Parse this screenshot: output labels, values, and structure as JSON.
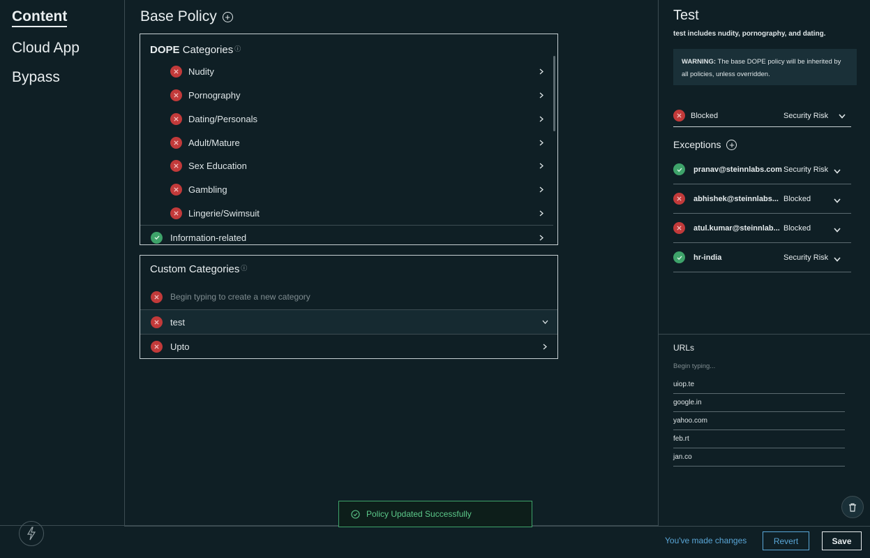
{
  "sidebar": {
    "items": [
      {
        "label": "Content"
      },
      {
        "label": "Cloud App"
      },
      {
        "label": "Bypass"
      }
    ]
  },
  "main": {
    "title": "Base Policy",
    "dope_panel": {
      "heading_bold": "DOPE",
      "heading_rest": "Categories",
      "items": [
        {
          "label": "Nudity",
          "status": "blocked"
        },
        {
          "label": "Pornography",
          "status": "blocked"
        },
        {
          "label": "Dating/Personals",
          "status": "blocked"
        },
        {
          "label": "Adult/Mature",
          "status": "blocked"
        },
        {
          "label": "Sex Education",
          "status": "blocked"
        },
        {
          "label": "Gambling",
          "status": "blocked"
        },
        {
          "label": "Lingerie/Swimsuit",
          "status": "blocked"
        }
      ],
      "next_group": {
        "label": "Information-related",
        "status": "allowed"
      }
    },
    "custom_panel": {
      "heading": "Custom Categories",
      "new_placeholder": "Begin typing to create a new category",
      "items": [
        {
          "label": "test",
          "status": "blocked",
          "expanded": true
        },
        {
          "label": "Upto",
          "status": "blocked",
          "expanded": false
        }
      ]
    }
  },
  "detail": {
    "title": "Test",
    "description": "test includes nudity, pornography, and dating.",
    "warning_bold": "WARNING:",
    "warning_text": " The base DOPE policy will be inherited by all policies, unless overridden.",
    "base_action": {
      "status_label": "Blocked",
      "reason": "Security Risk"
    },
    "exceptions_heading": "Exceptions",
    "exceptions": [
      {
        "name": "pranav@steinnlabs.com",
        "action": "Security Risk",
        "status": "allowed"
      },
      {
        "name": "abhishek@steinnlabs...",
        "action": "Blocked",
        "status": "blocked"
      },
      {
        "name": "atul.kumar@steinnlab...",
        "action": "Blocked",
        "status": "blocked"
      },
      {
        "name": "hr-india",
        "action": "Security Risk",
        "status": "allowed"
      }
    ],
    "urls_heading": "URLs",
    "urls_placeholder": "Begin typing...",
    "urls": [
      "uiop.te",
      "google.in",
      "yahoo.com",
      "feb.rt",
      "jan.co"
    ]
  },
  "toast": {
    "message": "Policy Updated Successfully"
  },
  "footer": {
    "changes_text": "You've made changes",
    "revert_label": "Revert",
    "save_label": "Save"
  },
  "colors": {
    "background": "#0f1f25",
    "blocked": "#c23a3a",
    "allowed": "#3ea36a",
    "link": "#5aa7d8"
  }
}
